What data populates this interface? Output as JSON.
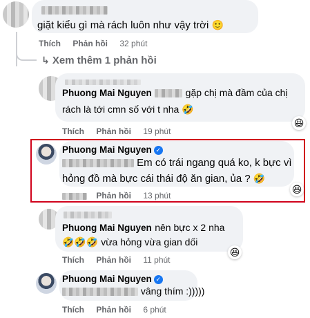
{
  "comment1": {
    "text": "giặt kiểu gì mà rách luôn như vậy trời",
    "emoji": "🙂",
    "like": "Thích",
    "reply": "Phản hồi",
    "time": "32 phút"
  },
  "view_more": {
    "icon": "reply-arrow-icon",
    "label": "Xem thêm 1 phản hồi"
  },
  "reply1": {
    "author": "Phuong Mai Nguyen",
    "text_a": "gặp chị mà đầm của chị",
    "text_b": "rách là tới cmn số với t nha",
    "emoji": "🤣",
    "like": "Thích",
    "reply": "Phản hồi",
    "time": "19 phút",
    "reaction": "😆"
  },
  "reply2": {
    "author": "Phuong Mai Nguyen",
    "text_a": "Em có trái ngang quá ko, k bực vì",
    "text_b": "hỏng đồ mà bực cái thái độ ăn gian, ủa ?",
    "emoji": "🤣",
    "like": "Thích",
    "reply": "Phản hồi",
    "time": "13 phút",
    "reaction": "😆",
    "highlight_color": "#d0021b"
  },
  "reply3": {
    "author": "Phuong Mai Nguyen",
    "text_a": "nên bực x 2 nha",
    "emojis": "🤣🤣🤣",
    "text_b": "vừa hỏng vừa gian dối",
    "like": "Thích",
    "reply": "Phản hồi",
    "time": "11 phút",
    "reaction": "😆"
  },
  "reply4": {
    "author": "Phuong Mai Nguyen",
    "text": "vâng thím :)))))",
    "like": "Thích",
    "reply": "Phản hồi",
    "time": "6 phút"
  },
  "colors": {
    "bubble": "#f0f2f5",
    "meta": "#65676b",
    "verified": "#1877f2"
  }
}
